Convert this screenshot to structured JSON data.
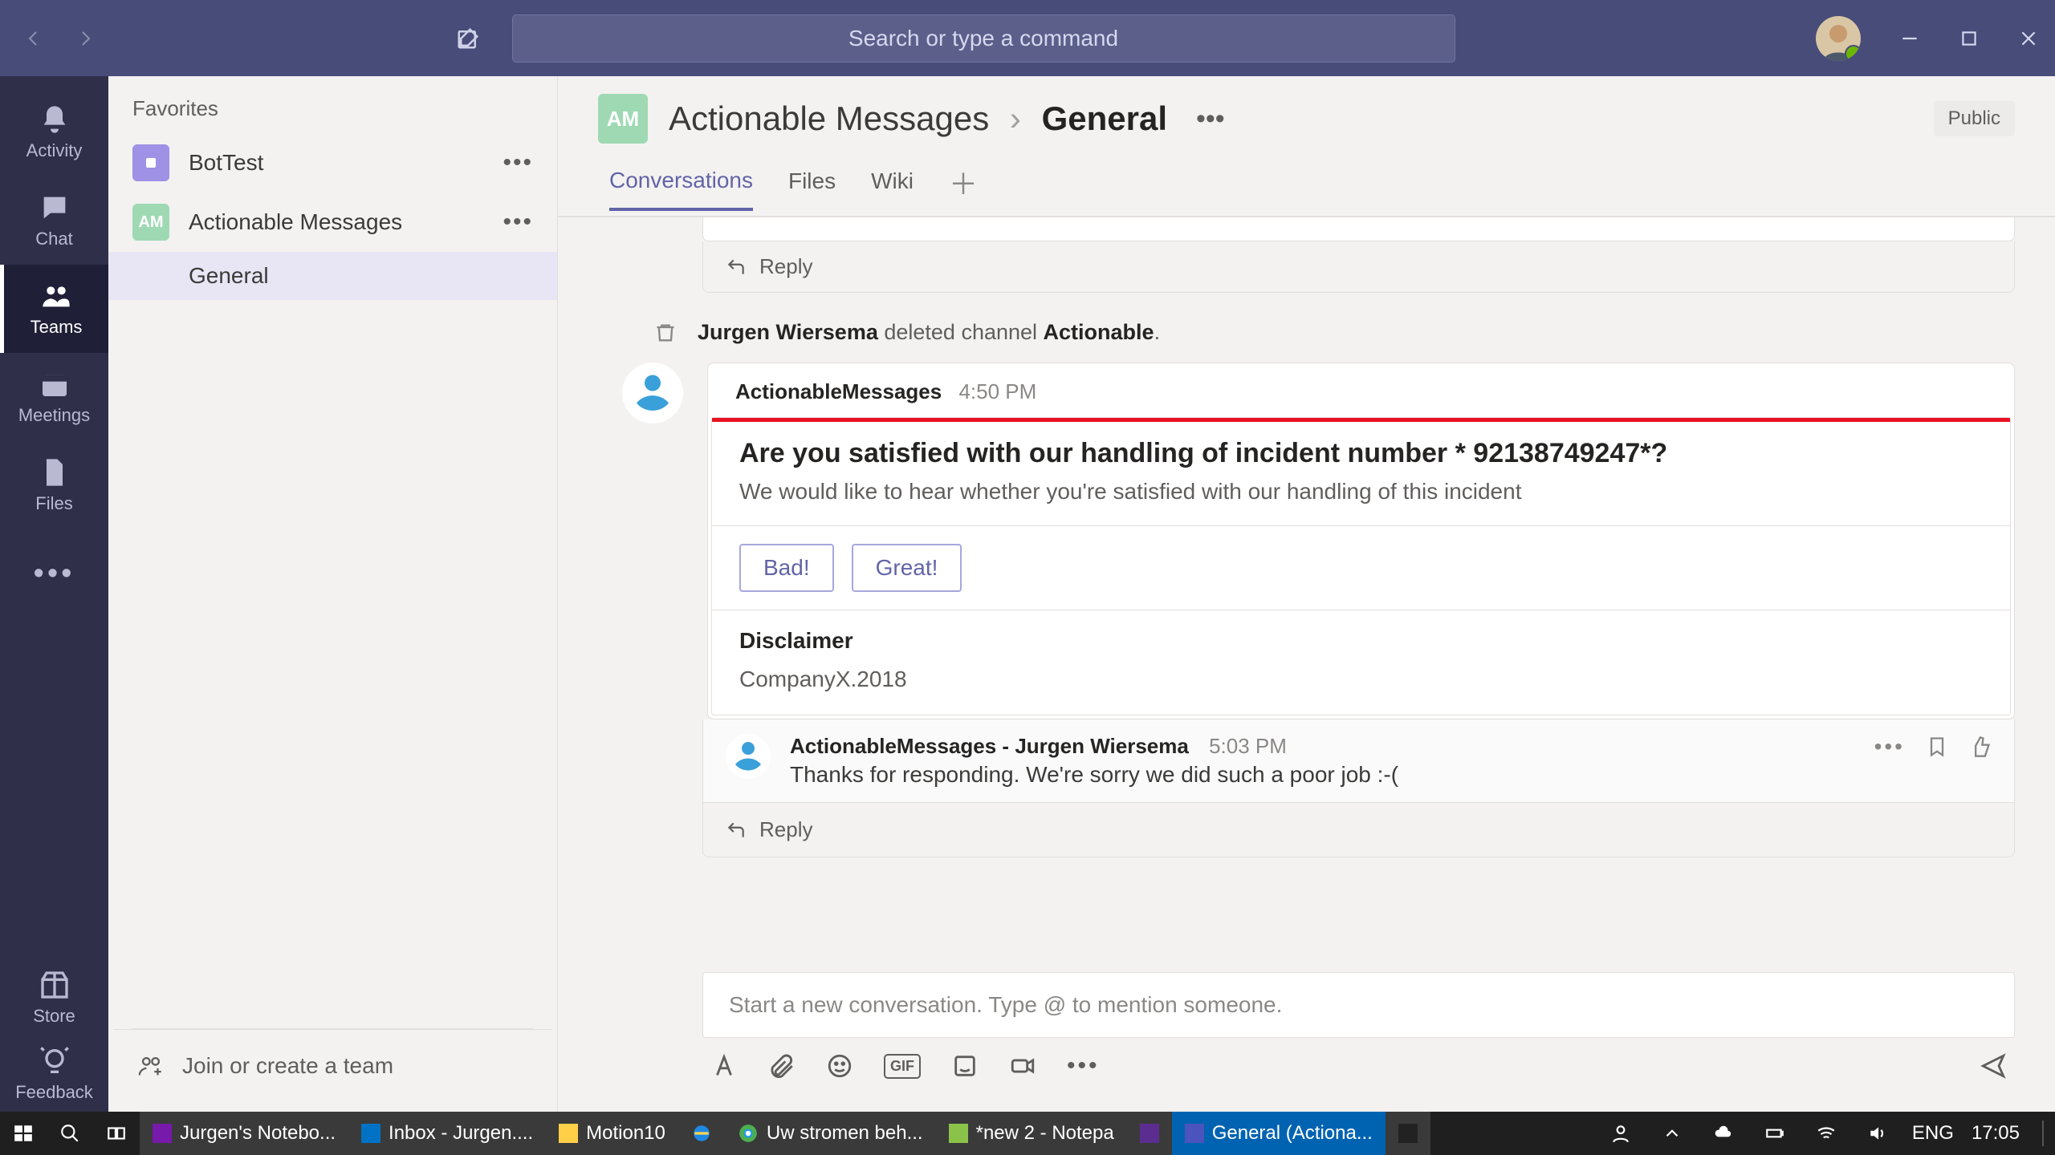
{
  "titlebar": {
    "search_placeholder": "Search or type a command"
  },
  "rail": {
    "items": [
      {
        "label": "Activity"
      },
      {
        "label": "Chat"
      },
      {
        "label": "Teams"
      },
      {
        "label": "Meetings"
      },
      {
        "label": "Files"
      }
    ],
    "store": "Store",
    "feedback": "Feedback"
  },
  "sidebar": {
    "favorites": "Favorites",
    "teams": [
      {
        "initials": "",
        "name": "BotTest",
        "color": "#9e91e6"
      },
      {
        "initials": "AM",
        "name": "Actionable Messages",
        "color": "#9fd9b4"
      }
    ],
    "channels": [
      {
        "name": "General"
      }
    ],
    "join": "Join or create a team"
  },
  "header": {
    "team_initials": "AM",
    "team": "Actionable Messages",
    "channel": "General",
    "badge": "Public"
  },
  "tabs": [
    "Conversations",
    "Files",
    "Wiki"
  ],
  "sys": {
    "user": "Jurgen Wiersema",
    "mid": " deleted channel ",
    "channel": "Actionable",
    "tail": "."
  },
  "card_msg": {
    "who": "ActionableMessages",
    "when": "4:50 PM",
    "title": "Are you satisfied with our handling of incident number * 92138749247*?",
    "subtitle": "We would like to hear whether you're satisfied with our handling of this incident",
    "actions": [
      "Bad!",
      "Great!"
    ],
    "disclaimer_label": "Disclaimer",
    "disclaimer_text": "CompanyX.2018"
  },
  "followup": {
    "who": "ActionableMessages - Jurgen Wiersema",
    "when": "5:03 PM",
    "text": "Thanks for responding. We're sorry we did such a poor job :-("
  },
  "reply_label": "Reply",
  "composer": {
    "placeholder": "Start a new conversation. Type @ to mention someone.",
    "gif": "GIF"
  },
  "taskbar": {
    "apps": [
      {
        "label": "Jurgen's Notebo..."
      },
      {
        "label": "Inbox - Jurgen...."
      },
      {
        "label": "Motion10"
      },
      {
        "label": ""
      },
      {
        "label": "Uw stromen beh..."
      },
      {
        "label": "*new 2 - Notepa"
      },
      {
        "label": ""
      },
      {
        "label": "General (Actiona..."
      },
      {
        "label": ""
      }
    ],
    "lang": "ENG",
    "clock": "17:05"
  }
}
